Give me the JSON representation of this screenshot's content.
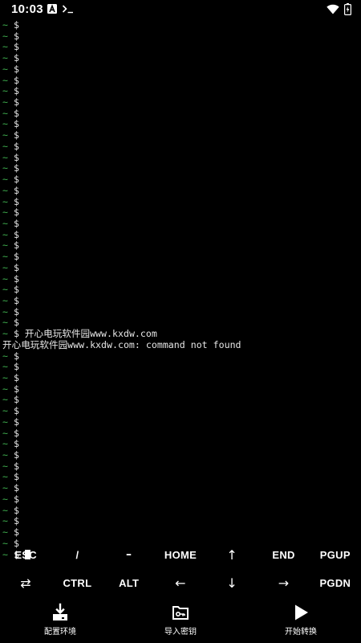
{
  "status_bar": {
    "time": "10:03",
    "icons": [
      "app-a-icon",
      "terminal-app-icon",
      "wifi-icon",
      "battery-icon"
    ]
  },
  "terminal": {
    "lines": [
      {
        "prefix": "~",
        "text": " $"
      },
      {
        "prefix": "~",
        "text": " $"
      },
      {
        "prefix": "~",
        "text": " $"
      },
      {
        "prefix": "~",
        "text": " $"
      },
      {
        "prefix": "~",
        "text": " $"
      },
      {
        "prefix": "~",
        "text": " $"
      },
      {
        "prefix": "~",
        "text": " $"
      },
      {
        "prefix": "~",
        "text": " $"
      },
      {
        "prefix": "~",
        "text": " $"
      },
      {
        "prefix": "~",
        "text": " $"
      },
      {
        "prefix": "~",
        "text": " $"
      },
      {
        "prefix": "~",
        "text": " $"
      },
      {
        "prefix": "~",
        "text": " $"
      },
      {
        "prefix": "~",
        "text": " $"
      },
      {
        "prefix": "~",
        "text": " $"
      },
      {
        "prefix": "~",
        "text": " $"
      },
      {
        "prefix": "~",
        "text": " $"
      },
      {
        "prefix": "~",
        "text": " $"
      },
      {
        "prefix": "~",
        "text": " $"
      },
      {
        "prefix": "~",
        "text": " $"
      },
      {
        "prefix": "~",
        "text": " $"
      },
      {
        "prefix": "~",
        "text": " $"
      },
      {
        "prefix": "~",
        "text": " $"
      },
      {
        "prefix": "~",
        "text": " $"
      },
      {
        "prefix": "~",
        "text": " $"
      },
      {
        "prefix": "~",
        "text": " $"
      },
      {
        "prefix": "~",
        "text": " $"
      },
      {
        "prefix": "~",
        "text": " $"
      },
      {
        "prefix": "~",
        "text": " $ 开心电玩软件园www.kxdw.com"
      },
      {
        "prefix": "",
        "text": "开心电玩软件园www.kxdw.com: command not found"
      },
      {
        "prefix": "~",
        "text": " $"
      },
      {
        "prefix": "~",
        "text": " $"
      },
      {
        "prefix": "~",
        "text": " $"
      },
      {
        "prefix": "~",
        "text": " $"
      },
      {
        "prefix": "~",
        "text": " $"
      },
      {
        "prefix": "~",
        "text": " $"
      },
      {
        "prefix": "~",
        "text": " $"
      },
      {
        "prefix": "~",
        "text": " $"
      },
      {
        "prefix": "~",
        "text": " $"
      },
      {
        "prefix": "~",
        "text": " $"
      },
      {
        "prefix": "~",
        "text": " $"
      },
      {
        "prefix": "~",
        "text": " $"
      },
      {
        "prefix": "~",
        "text": " $"
      },
      {
        "prefix": "~",
        "text": " $"
      },
      {
        "prefix": "~",
        "text": " $"
      },
      {
        "prefix": "~",
        "text": " $"
      },
      {
        "prefix": "~",
        "text": " $"
      },
      {
        "prefix": "~",
        "text": " $"
      }
    ],
    "prompt": {
      "prefix": "~",
      "text": " $ "
    }
  },
  "extra_keys": {
    "row1": [
      {
        "name": "esc-key",
        "label": "ESC"
      },
      {
        "name": "slash-key",
        "label": "/"
      },
      {
        "name": "dash-key",
        "label": "–"
      },
      {
        "name": "home-key",
        "label": "HOME"
      },
      {
        "name": "up-arrow-key",
        "label": "↑"
      },
      {
        "name": "end-key",
        "label": "END"
      },
      {
        "name": "pgup-key",
        "label": "PGUP"
      }
    ],
    "row2": [
      {
        "name": "tab-key",
        "label": "⇄"
      },
      {
        "name": "ctrl-key",
        "label": "CTRL"
      },
      {
        "name": "alt-key",
        "label": "ALT"
      },
      {
        "name": "left-arrow-key",
        "label": "←"
      },
      {
        "name": "down-arrow-key",
        "label": "↓"
      },
      {
        "name": "right-arrow-key",
        "label": "→"
      },
      {
        "name": "pgdn-key",
        "label": "PGDN"
      }
    ]
  },
  "toolbar": {
    "configure_env_label": "配置环境",
    "import_key_label": "导入密钥",
    "start_convert_label": "开始转换"
  },
  "colors": {
    "background": "#000000",
    "tilde_green": "#3fae4f",
    "text": "#e6e6e6",
    "battery_accent": "#ffffff"
  }
}
